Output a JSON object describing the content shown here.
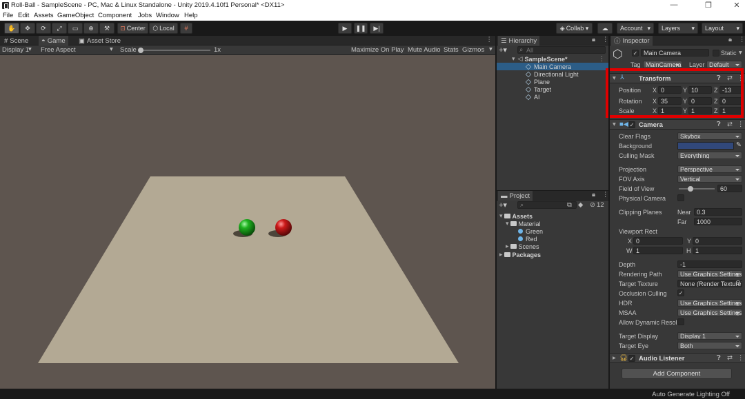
{
  "window": {
    "title": "Roll-Ball - SampleScene - PC, Mac & Linux Standalone - Unity 2019.4.10f1 Personal* <DX11>",
    "minimize": "—",
    "maximize": "❐",
    "close": "✕"
  },
  "menu": [
    "File",
    "Edit",
    "Assets",
    "GameObject",
    "Component",
    "Jobs",
    "Window",
    "Help"
  ],
  "toolbar": {
    "pivot_label": "Center",
    "space_label": "Local",
    "collab_label": "Collab ▾",
    "account_label": "Account",
    "layers_label": "Layers",
    "layout_label": "Layout"
  },
  "tabs": {
    "scene": "Scene",
    "game": "Game",
    "asset_store": "Asset Store",
    "hierarchy": "Hierarchy",
    "project": "Project",
    "inspector": "Inspector"
  },
  "game_bar": {
    "display": "Display 1",
    "aspect": "Free Aspect",
    "scale_label": "Scale",
    "scale_value": "1x",
    "maximize": "Maximize On Play",
    "mute": "Mute Audio",
    "stats": "Stats",
    "gizmos": "Gizmos"
  },
  "hierarchy": {
    "search_placeholder": "All",
    "scene": "SampleScene*",
    "items": [
      "Main Camera",
      "Directional Light",
      "Plane",
      "Target",
      "AI"
    ],
    "selected": "Main Camera"
  },
  "project": {
    "hidden_count": "12",
    "assets": "Assets",
    "material": "Material",
    "green": "Green",
    "red": "Red",
    "scenes": "Scenes",
    "packages": "Packages"
  },
  "inspector": {
    "object_name": "Main Camera",
    "static_label": "Static",
    "tag_label": "Tag",
    "tag_value": "MainCamera",
    "layer_label": "Layer",
    "layer_value": "Default",
    "transform": {
      "title": "Transform",
      "position_label": "Position",
      "rotation_label": "Rotation",
      "scale_label": "Scale",
      "x": "X",
      "y": "Y",
      "z": "Z",
      "position": [
        "0",
        "10",
        "-13"
      ],
      "rotation": [
        "35",
        "0",
        "0"
      ],
      "scale": [
        "1",
        "1",
        "1"
      ]
    },
    "camera": {
      "title": "Camera",
      "clear_flags_label": "Clear Flags",
      "clear_flags": "Skybox",
      "background_label": "Background",
      "background_color": "#31487a",
      "culling_mask_label": "Culling Mask",
      "culling_mask": "Everything",
      "projection_label": "Projection",
      "projection": "Perspective",
      "fov_axis_label": "FOV Axis",
      "fov_axis": "Vertical",
      "fov_label": "Field of View",
      "fov": "60",
      "fov_slider_fraction": 0.33,
      "physical_label": "Physical Camera",
      "clipping_label": "Clipping Planes",
      "near_label": "Near",
      "near": "0.3",
      "far_label": "Far",
      "far": "1000",
      "viewport_label": "Viewport Rect",
      "vx_label": "X",
      "vx": "0",
      "vy_label": "Y",
      "vy": "0",
      "vw_label": "W",
      "vw": "1",
      "vh_label": "H",
      "vh": "1",
      "depth_label": "Depth",
      "depth": "-1",
      "rendering_path_label": "Rendering Path",
      "rendering_path": "Use Graphics Settings",
      "target_texture_label": "Target Texture",
      "target_texture": "None (Render Texture)",
      "occlusion_label": "Occlusion Culling",
      "hdr_label": "HDR",
      "hdr": "Use Graphics Settings",
      "msaa_label": "MSAA",
      "msaa": "Use Graphics Settings",
      "dynamic_res_label": "Allow Dynamic Resolution",
      "target_display_label": "Target Display",
      "target_display": "Display 1",
      "target_eye_label": "Target Eye",
      "target_eye": "Both"
    },
    "audio_listener": "Audio Listener",
    "add_component": "Add Component"
  },
  "status": "Auto Generate Lighting Off",
  "colors": {
    "highlight": "#e00000",
    "selection": "#2c5d87",
    "green_ball": "#1fb21f",
    "red_ball": "#cc1a1a",
    "plane": "#b3a994"
  }
}
